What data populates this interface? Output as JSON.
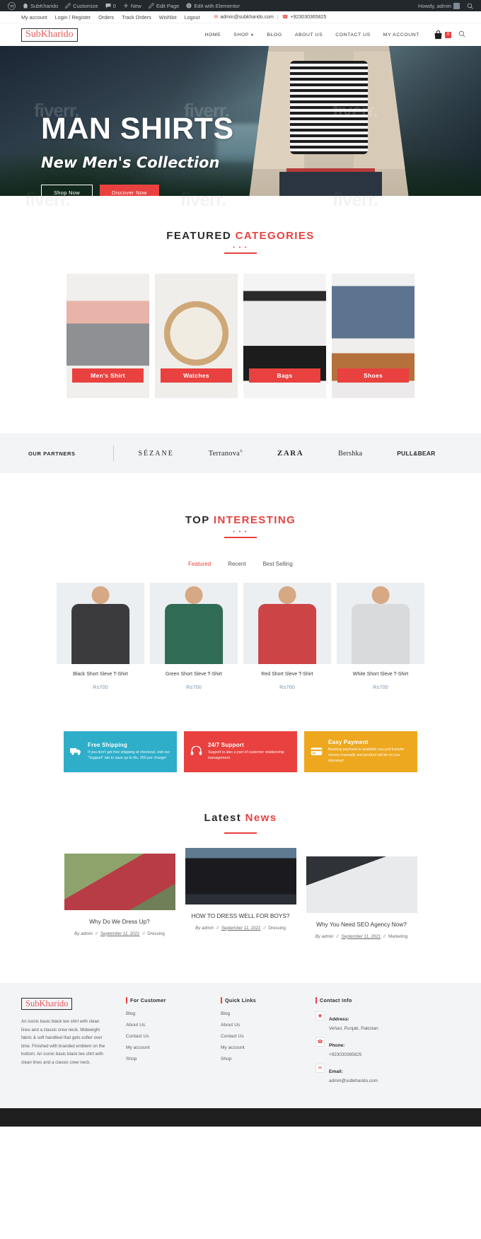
{
  "adminbar": {
    "items": [
      {
        "name": "wp-logo",
        "label": ""
      },
      {
        "name": "site-name",
        "label": "SubKharido"
      },
      {
        "name": "customize",
        "label": "Customize"
      },
      {
        "name": "comments",
        "label": "0"
      },
      {
        "name": "new",
        "label": "New"
      },
      {
        "name": "edit-page",
        "label": "Edit Page"
      },
      {
        "name": "edit-elementor",
        "label": "Edit with Elementor"
      }
    ],
    "howdy": "Howdy, admin"
  },
  "topbar": {
    "links": [
      "My account",
      "Login / Register",
      "Orders",
      "Track Orders",
      "Wishlist",
      "Logout"
    ],
    "email": "admin@subkharido.com",
    "separator": "|",
    "phone": "+923030365825"
  },
  "header": {
    "logo": "SubKharido",
    "nav": [
      {
        "label": "HOME",
        "has_caret": false
      },
      {
        "label": "SHOP",
        "has_caret": true
      },
      {
        "label": "BLOG",
        "has_caret": false
      },
      {
        "label": "ABOUT US",
        "has_caret": false
      },
      {
        "label": "CONTACT US",
        "has_caret": false
      },
      {
        "label": "MY ACCOUNT",
        "has_caret": false
      }
    ],
    "cart_count": "0"
  },
  "hero": {
    "title": "MAN SHIRTS",
    "subtitle": "New Men's Collection",
    "btn_primary": "Shop Now",
    "btn_secondary": "Discover Now",
    "watermark": "fiverr."
  },
  "featured": {
    "title_plain": "FEATURED ",
    "title_hl": "CATEGORIES",
    "dots": "• • •",
    "categories": [
      {
        "label": "Men's Shirt",
        "art": "ph-shirt"
      },
      {
        "label": "Watches",
        "art": "ph-watch"
      },
      {
        "label": "Bags",
        "art": "ph-bag"
      },
      {
        "label": "Shoes",
        "art": "ph-shoes"
      }
    ]
  },
  "partners": {
    "title": "OUR PARTNERS",
    "brands": [
      "SÉZANE",
      "Terranova",
      "ZARA",
      "Bershka",
      "PULL&BEAR"
    ]
  },
  "interesting": {
    "title_plain": "TOP ",
    "title_hl": "INTERESTING",
    "dots": "• • •",
    "tabs": [
      {
        "label": "Featured",
        "active": true
      },
      {
        "label": "Recent",
        "active": false
      },
      {
        "label": "Best Selling",
        "active": false
      }
    ],
    "products": [
      {
        "name": "Black Short Sleve T-Shirt",
        "price": "Rs700",
        "art": "tee-black"
      },
      {
        "name": "Green Short Sleve T-Shirt",
        "price": "Rs700",
        "art": "tee-green"
      },
      {
        "name": "Red Short Sleve T-Shirt",
        "price": "Rs760",
        "art": "tee-red"
      },
      {
        "name": "White Short Sleve T-Shirt",
        "price": "Rs700",
        "art": "tee-white"
      }
    ]
  },
  "services": [
    {
      "icon": "truck-icon",
      "glyph": "⛟",
      "title": "Free Shipping",
      "desc": "If you don't get free shipping at checkout, visit our \"Support\" tab to save up to Rs. 250 per charge!",
      "color": "#2eaec8"
    },
    {
      "icon": "headset-icon",
      "glyph": "☎",
      "title": "24/7 Support",
      "desc": "Support is also a part of customer relationship management.",
      "color": "#e8413f"
    },
    {
      "icon": "card-icon",
      "glyph": "▤",
      "title": "Easy Payment",
      "desc": "Banking payment is available you just transfer money manually and product will be on you doorstep!",
      "color": "#eda81f"
    }
  ],
  "news": {
    "title_plain": "Latest ",
    "title_hl": "News",
    "posts": [
      {
        "title": "Why Do We Dress Up?",
        "by": "By admin",
        "date": "September 11, 2021",
        "cat": "Dressing",
        "art": "th1"
      },
      {
        "title": "HOW TO DRESS WELL FOR BOYS?",
        "by": "By admin",
        "date": "September 11, 2021",
        "cat": "Dressing",
        "art": "th2"
      },
      {
        "title": "Why You Need SEO Agency Now?",
        "by": "By admin",
        "date": "September 11, 2021",
        "cat": "Marketing",
        "art": "th3"
      }
    ],
    "slash": "//"
  },
  "footer": {
    "logo": "SubKharido",
    "about": "An iconic basic black tee shirt with clean lines and a classic crew neck. Midweight fabric & soft handfeel that gets softer over time. Finished with branded emblem on the bottom. An iconic basic black tee shirt with clean lines and a classic crew neck.",
    "col_customer": {
      "heading": "For Customer",
      "links": [
        "Blog",
        "About Us",
        "Contact Us",
        "My account",
        "Shop"
      ]
    },
    "col_quick": {
      "heading": "Quick Links",
      "links": [
        "Blog",
        "About Us",
        "Contact Us",
        "My account",
        "Shop"
      ]
    },
    "col_contact": {
      "heading": "Contact Info",
      "items": [
        {
          "icon": "location-icon",
          "glyph": "◉",
          "label": "Address:",
          "value": "Vehari, Punjab, Pakistan"
        },
        {
          "icon": "phone-icon",
          "glyph": "✆",
          "label": "Phone:",
          "value": "+923030365825"
        },
        {
          "icon": "mail-icon",
          "glyph": "✉",
          "label": "Email:",
          "value": "admin@subkharido.com"
        }
      ]
    }
  },
  "watermark": {
    "text": "fiverr."
  }
}
